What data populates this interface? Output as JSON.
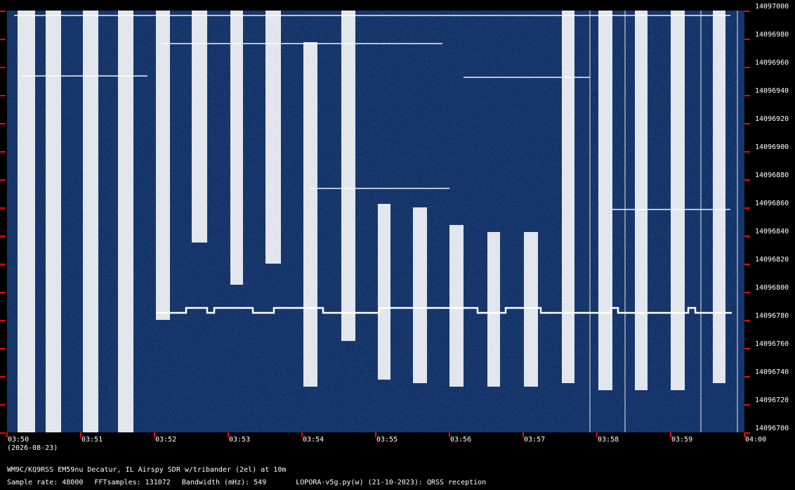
{
  "window": {
    "type": "qrss-waterfall-grabber",
    "background_color": "#000000",
    "spectrum_color": "#0e2f66",
    "signal_color": "#ffffff",
    "tick_color": "#ff0000"
  },
  "freq_axis": {
    "min": 14096700,
    "max": 14097000,
    "ticks": [
      "14097000",
      "14096980",
      "14096960",
      "14096940",
      "14096920",
      "14096900",
      "14096880",
      "14096860",
      "14096840",
      "14096820",
      "14096800",
      "14096780",
      "14096760",
      "14096740",
      "14096720",
      "14096700"
    ]
  },
  "time_axis": {
    "ticks": [
      "03:50",
      "03:51",
      "03:52",
      "03:53",
      "03:54",
      "03:55",
      "03:56",
      "03:57",
      "03:58",
      "03:59",
      "04:00"
    ],
    "date": "(2026-08-23)"
  },
  "header": {
    "station": "WM9C/KQ9RSS EM59nu Decatur, IL  Airspy SDR w/tribander (2el) at 10m"
  },
  "footer": {
    "sample_rate": "Sample rate: 48000",
    "fft_samples": "FFTsamples: 131072",
    "bandwidth": "Bandwidth (mHz): 549",
    "software": "LOPORA-v5g.py(w) (21-10-2023): QRSS reception"
  }
}
